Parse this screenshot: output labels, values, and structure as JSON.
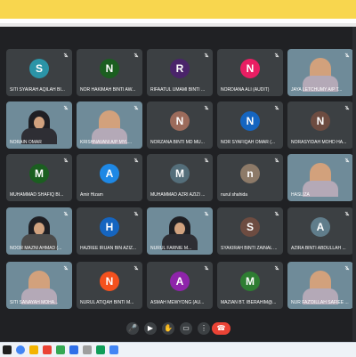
{
  "participants": [
    {
      "name": "SITI SYAIRAH AQILAH BI...",
      "initial": "S",
      "color": "#2b94a7",
      "kind": "avatar"
    },
    {
      "name": "NOR HAKIMAH BINTI AW...",
      "initial": "N",
      "color": "#1b5e20",
      "kind": "avatar"
    },
    {
      "name": "RIFAATUL UMAMI BINTI ...",
      "initial": "R",
      "color": "#4a246a",
      "kind": "avatar"
    },
    {
      "name": "NORDIANA ALI (AUDIT)",
      "initial": "N",
      "color": "#e91e63",
      "kind": "avatar"
    },
    {
      "name": "JAYA LETCHUMY A/P T...",
      "initial": "",
      "color": "#8a6a4e",
      "kind": "video"
    },
    {
      "name": "NORAIN OMAR",
      "initial": "",
      "color": "#8a6a4e",
      "kind": "video"
    },
    {
      "name": "KRISHNAVANI A/P MYL...",
      "initial": "",
      "color": "#8a6a4e",
      "kind": "video"
    },
    {
      "name": "NORZANA BINTI MD MU...",
      "initial": "N",
      "color": "#9c6b5b",
      "kind": "avatar"
    },
    {
      "name": "NOR SYAFIQAH OMAR (...",
      "initial": "N",
      "color": "#1565c0",
      "kind": "avatar"
    },
    {
      "name": "NORASYIDAH MOHD HA...",
      "initial": "N",
      "color": "#6d4c41",
      "kind": "avatar"
    },
    {
      "name": "MUHAMMAD SHAFIQ BI...",
      "initial": "M",
      "color": "#1b5e20",
      "kind": "avatar"
    },
    {
      "name": "Amir Hizam",
      "initial": "A",
      "color": "#1e88e5",
      "kind": "avatar"
    },
    {
      "name": "MUHAMMAD AZRI AZIZI ...",
      "initial": "M",
      "color": "#546e7a",
      "kind": "avatar"
    },
    {
      "name": "nurul shahida",
      "initial": "n",
      "color": "#8d7a68",
      "kind": "avatar"
    },
    {
      "name": "HASLIZA",
      "initial": "",
      "color": "#8a6a4e",
      "kind": "video"
    },
    {
      "name": "NOOR MAZNI AHMAD (...",
      "initial": "",
      "color": "#8a6a4e",
      "kind": "video"
    },
    {
      "name": "HAZREE IRUAN BIN AZIZ...",
      "initial": "H",
      "color": "#1565c0",
      "kind": "avatar"
    },
    {
      "name": "NURUL FARNIE M...",
      "initial": "",
      "color": "#8a6a4e",
      "kind": "video"
    },
    {
      "name": "SYAKIRAH BINTI ZAINAL ...",
      "initial": "S",
      "color": "#6d4c41",
      "kind": "avatar"
    },
    {
      "name": "AZIRA BINTI ABDULLAH ...",
      "initial": "A",
      "color": "#607d8b",
      "kind": "avatar"
    },
    {
      "name": "SITI SANAYAH MOHA...",
      "initial": "",
      "color": "#8a6a4e",
      "kind": "video"
    },
    {
      "name": "NURUL ATIQAH BINTI M...",
      "initial": "N",
      "color": "#f4511e",
      "kind": "avatar"
    },
    {
      "name": "ASMAH MEWYONG (AU...",
      "initial": "A",
      "color": "#8e24aa",
      "kind": "avatar"
    },
    {
      "name": "MAZIAN BT. IBERAHIM@...",
      "initial": "M",
      "color": "#2e7d32",
      "kind": "avatar"
    },
    {
      "name": "NUR FAZ'DILLAH SAFIEE ...",
      "initial": "",
      "color": "#8a6a4e",
      "kind": "video"
    }
  ],
  "controls": [
    {
      "label": "🎤"
    },
    {
      "label": "▶"
    },
    {
      "label": "✋"
    },
    {
      "label": "▭"
    },
    {
      "label": "⋮"
    },
    {
      "label": "☎"
    }
  ]
}
